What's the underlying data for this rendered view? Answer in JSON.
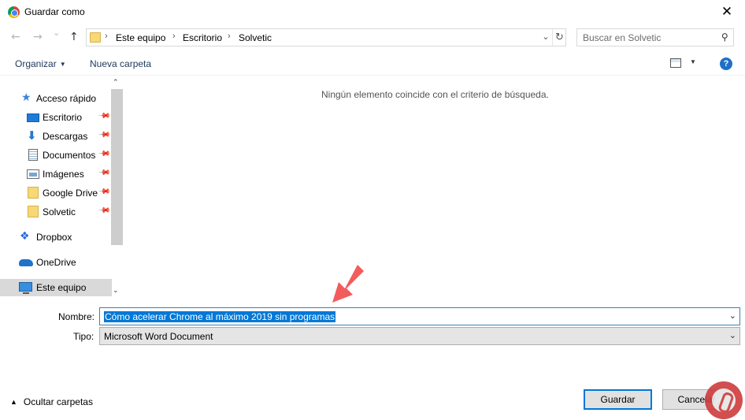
{
  "window": {
    "title": "Guardar como",
    "close_glyph": "✕"
  },
  "nav": {
    "back_glyph": "←",
    "forward_glyph": "→",
    "recent_glyph": "⌄",
    "up_glyph": "↑"
  },
  "address": {
    "crumbs": [
      "Este equipo",
      "Escritorio",
      "Solvetic"
    ],
    "separator": "›",
    "dropdown_glyph": "⌄",
    "refresh_glyph": "↻"
  },
  "search": {
    "placeholder": "Buscar en Solvetic",
    "icon": "search-icon",
    "glyph": "⚲"
  },
  "toolbar": {
    "organize": "Organizar",
    "organize_caret": "▼",
    "new_folder": "Nueva carpeta",
    "view_caret": "▼",
    "help": "?"
  },
  "sidebar": {
    "scroll_up": "⌃",
    "scroll_down": "⌄",
    "pin_glyph": "📌",
    "items": [
      {
        "label": "Acceso rápido",
        "icon": "star-icon"
      },
      {
        "label": "Escritorio",
        "icon": "desktop-icon",
        "pinned": true
      },
      {
        "label": "Descargas",
        "icon": "download-icon",
        "pinned": true
      },
      {
        "label": "Documentos",
        "icon": "documents-icon",
        "pinned": true
      },
      {
        "label": "Imágenes",
        "icon": "pictures-icon",
        "pinned": true
      },
      {
        "label": "Google Drive",
        "icon": "folder-icon",
        "pinned": true
      },
      {
        "label": "Solvetic",
        "icon": "folder-icon",
        "pinned": true
      },
      {
        "label": "Dropbox",
        "icon": "dropbox-icon"
      },
      {
        "label": "OneDrive",
        "icon": "onedrive-icon"
      },
      {
        "label": "Este equipo",
        "icon": "computer-icon",
        "selected": true
      }
    ]
  },
  "content": {
    "empty_message": "Ningún elemento coincide con el criterio de búsqueda."
  },
  "form": {
    "name_label": "Nombre:",
    "name_value": "Cómo acelerar Chrome al máximo 2019 sin programas",
    "type_label": "Tipo:",
    "type_value": "Microsoft Word Document",
    "dropdown_glyph": "⌄"
  },
  "footer": {
    "hide_folders": "Ocultar carpetas",
    "hide_caret": "▲",
    "save": "Guardar",
    "cancel": "Cancelar"
  },
  "colors": {
    "accent": "#0078d7",
    "selection": "#d9d9d9",
    "annotation_arrow": "#f25c5c"
  }
}
